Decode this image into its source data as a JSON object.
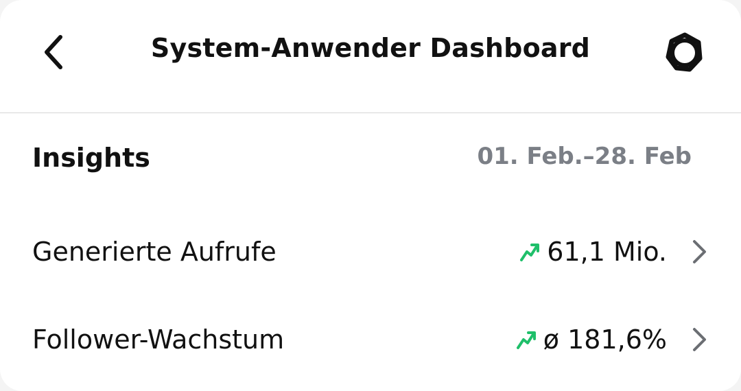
{
  "header": {
    "title": "System-Anwender Dashboard",
    "back_icon": "chevron-left-icon",
    "settings_icon": "gear-icon"
  },
  "insights": {
    "title": "Insights",
    "date_range": "01. Feb.–28. Feb",
    "rows": [
      {
        "label": "Generierte Aufrufe",
        "value": "61,1 Mio.",
        "trend": "up"
      },
      {
        "label": "Follower-Wachstum",
        "value": "ø 181,6%",
        "trend": "up"
      }
    ]
  },
  "colors": {
    "trend_up": "#1fbf6a",
    "secondary_text": "#7b7f86",
    "divider": "#d6d6d6"
  }
}
